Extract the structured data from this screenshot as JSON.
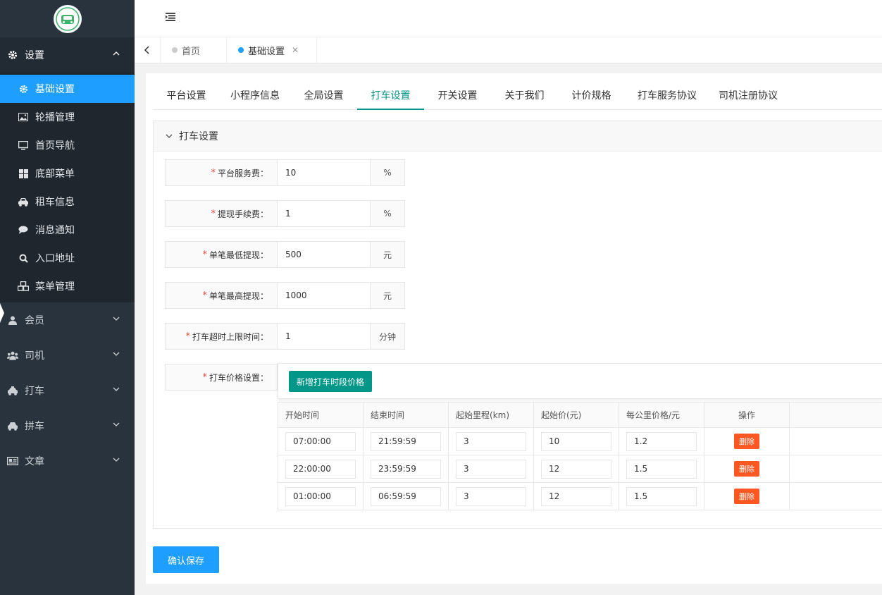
{
  "sidebar": {
    "groups": [
      {
        "label": "设置",
        "icon": "gear-icon"
      },
      {
        "label": "会员",
        "icon": "user-icon"
      },
      {
        "label": "司机",
        "icon": "users-icon"
      },
      {
        "label": "打车",
        "icon": "taxi-icon"
      },
      {
        "label": "拼车",
        "icon": "car-icon"
      },
      {
        "label": "文章",
        "icon": "newspaper-icon"
      }
    ],
    "submenu": [
      {
        "label": "基础设置",
        "icon": "gear-icon"
      },
      {
        "label": "轮播管理",
        "icon": "image-icon"
      },
      {
        "label": "首页导航",
        "icon": "monitor-icon"
      },
      {
        "label": "底部菜单",
        "icon": "grid-icon"
      },
      {
        "label": "租车信息",
        "icon": "car-icon"
      },
      {
        "label": "消息通知",
        "icon": "chat-icon"
      },
      {
        "label": "入口地址",
        "icon": "search-icon"
      },
      {
        "label": "菜单管理",
        "icon": "cubes-icon"
      }
    ]
  },
  "page_tabs": [
    {
      "label": "首页"
    },
    {
      "label": "基础设置"
    }
  ],
  "sub_tabs": [
    "平台设置",
    "小程序信息",
    "全局设置",
    "打车设置",
    "开关设置",
    "关于我们",
    "计价规格",
    "打车服务协议",
    "司机注册协议"
  ],
  "panel": {
    "title": "打车设置",
    "fields": [
      {
        "label": "平台服务费：",
        "value": "10",
        "unit": "%"
      },
      {
        "label": "提现手续费：",
        "value": "1",
        "unit": "%"
      },
      {
        "label": "单笔最低提现：",
        "value": "500",
        "unit": "元"
      },
      {
        "label": "单笔最高提现：",
        "value": "1000",
        "unit": "元"
      },
      {
        "label": "打车超时上限时间：",
        "value": "1",
        "unit": "分钟"
      }
    ],
    "price_label": "打车价格设置：",
    "add_button": "新增打车时段价格",
    "table": {
      "headers": [
        "开始时间",
        "结束时间",
        "起始里程(km)",
        "起始价(元)",
        "每公里价格/元",
        "操作"
      ],
      "rows": [
        {
          "start": "07:00:00",
          "end": "21:59:59",
          "km": "3",
          "base": "10",
          "per_km": "1.2"
        },
        {
          "start": "22:00:00",
          "end": "23:59:59",
          "km": "3",
          "base": "12",
          "per_km": "1.5"
        },
        {
          "start": "01:00:00",
          "end": "06:59:59",
          "km": "3",
          "base": "12",
          "per_km": "1.5"
        }
      ],
      "delete_label": "删除"
    }
  },
  "save_button": "确认保存",
  "colors": {
    "sidebar_bg": "#28333e",
    "active_blue": "#1e9fff",
    "teal": "#009688",
    "danger": "#ff5722"
  }
}
